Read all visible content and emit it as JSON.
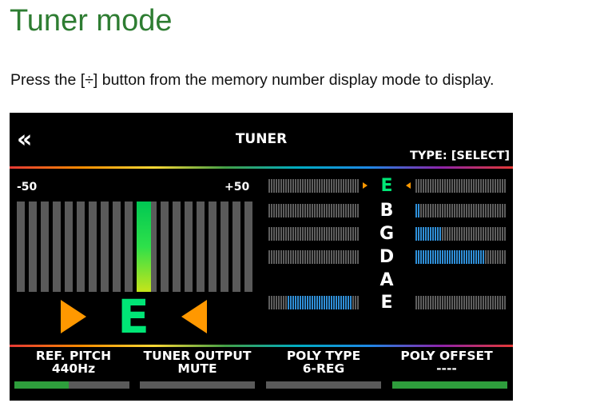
{
  "page": {
    "heading": "Tuner mode",
    "instruction": "Press the [÷] button from the memory number display mode to display."
  },
  "screen": {
    "back_glyph": "«",
    "title": "TUNER",
    "type_label": "TYPE: [SELECT]",
    "accent_color": "#00e676",
    "arrow_color": "#ff9800",
    "scale_min": "-50",
    "scale_max": "+50",
    "needle_cents": 0,
    "current_note": "E",
    "strings": [
      {
        "name": "E",
        "current": true,
        "left_level": 0,
        "right_level": 0
      },
      {
        "name": "B",
        "current": false,
        "left_level": 0,
        "right_level": 0.05
      },
      {
        "name": "G",
        "current": false,
        "left_level": 0,
        "right_level": 0.3
      },
      {
        "name": "D",
        "current": false,
        "left_level": 0,
        "right_level": 0.75
      },
      {
        "name": "A",
        "current": false,
        "left_level": null,
        "right_level": null
      },
      {
        "name": "E",
        "current": false,
        "left_level": 0.7,
        "right_level": 0
      }
    ],
    "params": [
      {
        "label": "REF. PITCH",
        "value": "440Hz",
        "level": 0.47
      },
      {
        "label": "TUNER OUTPUT",
        "value": "MUTE",
        "level": 0
      },
      {
        "label": "POLY TYPE",
        "value": "6-REG",
        "level": 0
      },
      {
        "label": "POLY OFFSET",
        "value": "----",
        "level": 1
      }
    ]
  }
}
